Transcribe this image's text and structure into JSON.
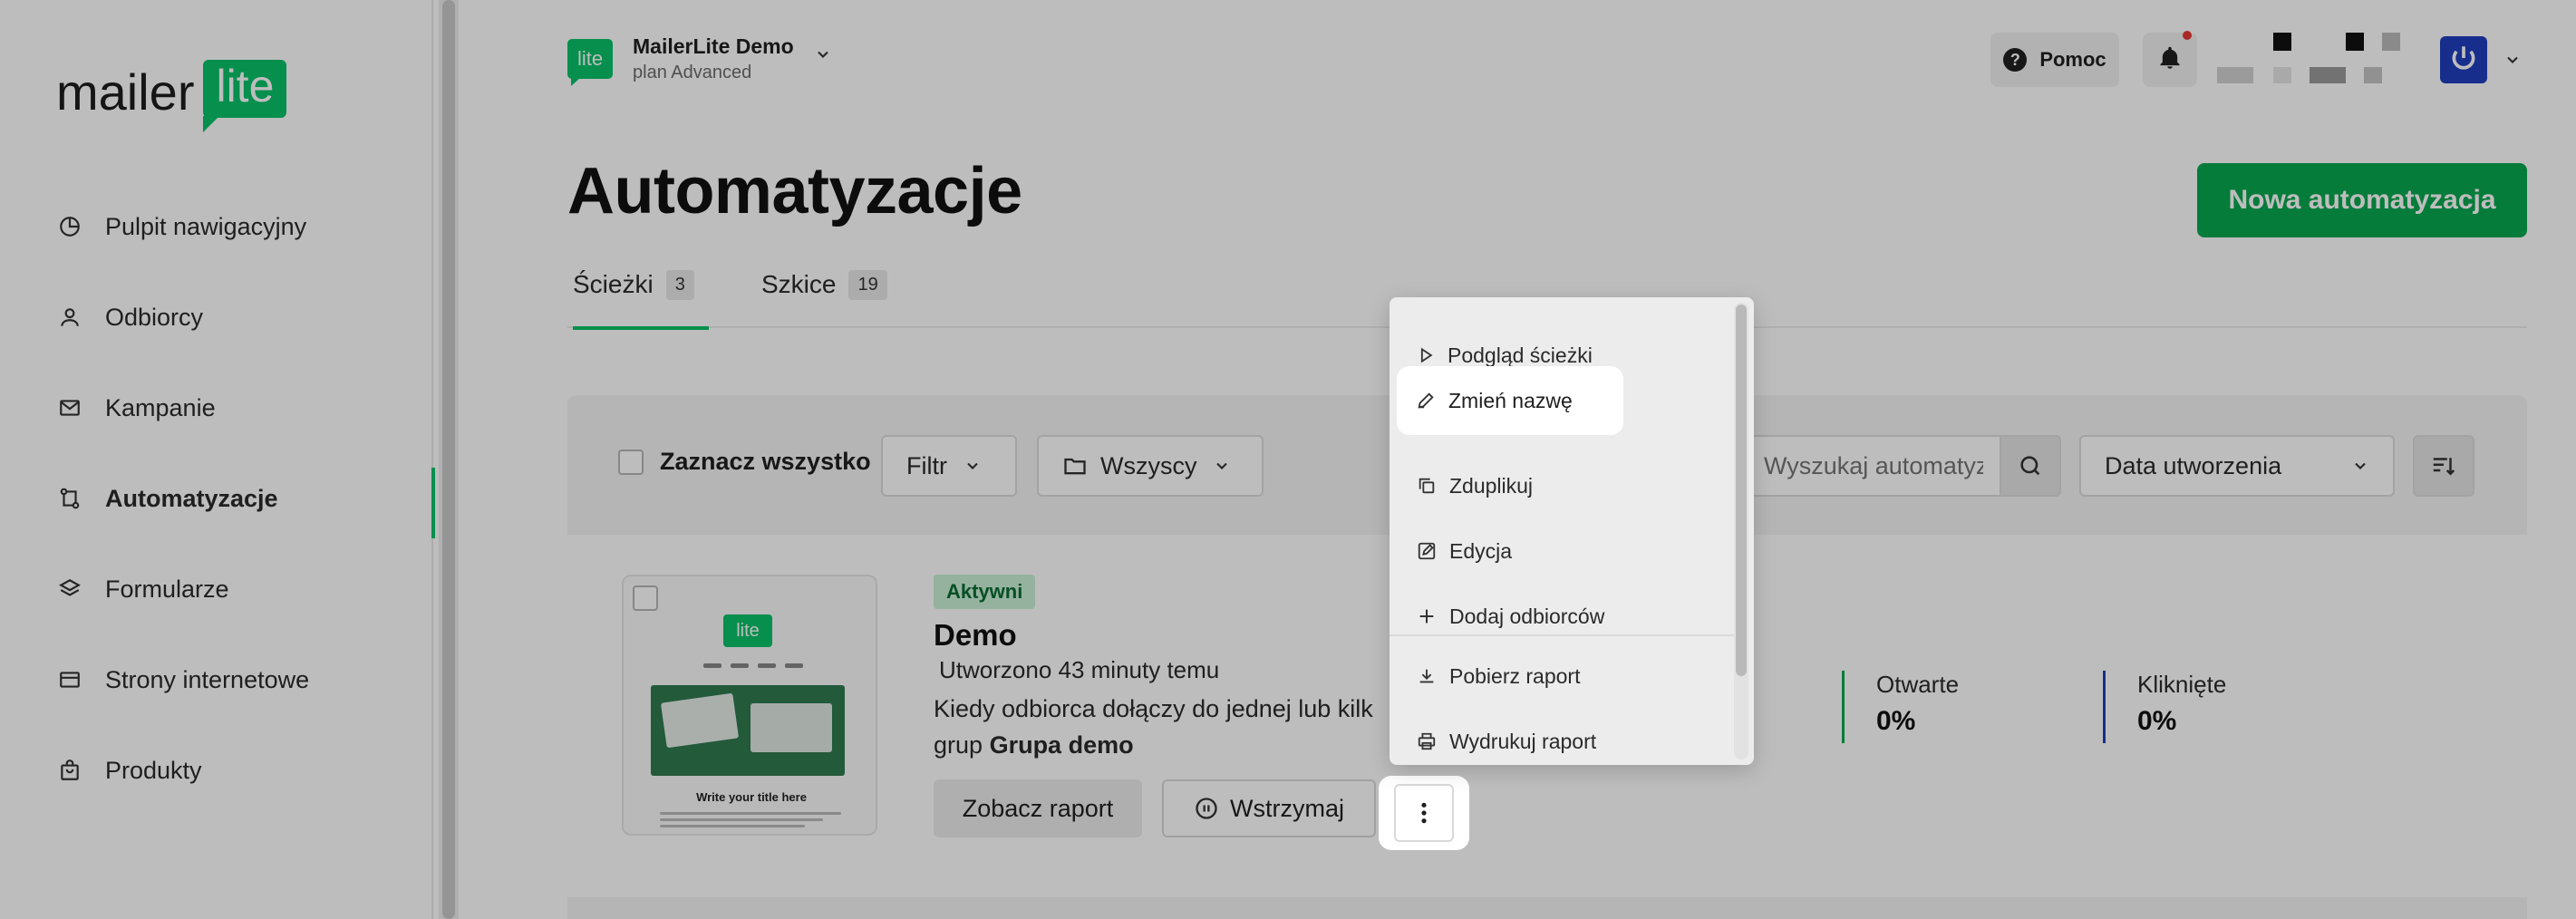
{
  "sidebar": {
    "logo": {
      "word": "mailer",
      "badge": "lite"
    },
    "items": [
      {
        "label": "Pulpit nawigacyjny",
        "icon": "dashboard-icon"
      },
      {
        "label": "Odbiorcy",
        "icon": "user-icon"
      },
      {
        "label": "Kampanie",
        "icon": "mail-icon"
      },
      {
        "label": "Automatyzacje",
        "icon": "automation-icon",
        "active": true
      },
      {
        "label": "Formularze",
        "icon": "layers-icon"
      },
      {
        "label": "Strony internetowe",
        "icon": "browser-icon"
      },
      {
        "label": "Produkty",
        "icon": "bag-icon"
      }
    ]
  },
  "header": {
    "account_logo": "lite",
    "account_name": "MailerLite Demo",
    "account_plan": "plan Advanced",
    "help_label": "Pomoc"
  },
  "page": {
    "title": "Automatyzacje",
    "new_button": "Nowa automatyzacja",
    "tabs": [
      {
        "label": "Ścieżki",
        "count": "3",
        "active": true
      },
      {
        "label": "Szkice",
        "count": "19"
      }
    ]
  },
  "toolbar": {
    "select_all": "Zaznacz wszystko",
    "filter": "Filtr",
    "group": "Wszyscy",
    "search_placeholder": "Wyszukaj automatyzacje",
    "sort": "Data utworzenia"
  },
  "automation": {
    "status": "Aktywni",
    "name": "Demo",
    "created": "Utworzono 43 minuty temu",
    "desc_prefix": "Kiedy odbiorca dołączy do jednej lub kilk",
    "desc_line2": "grup",
    "group_name": "Grupa demo",
    "report_button": "Zobacz raport",
    "pause_button": "Wstrzymaj",
    "thumb": {
      "logo": "lite",
      "title": "Write your title here"
    },
    "stats": [
      {
        "label": "Otwarte",
        "value": "0%",
        "color": "#09a84f"
      },
      {
        "label": "Kliknięte",
        "value": "0%",
        "color": "#1f3fbf"
      }
    ]
  },
  "menu": {
    "items": [
      {
        "label": "Podgląd ścieżki",
        "icon": "play-icon"
      },
      {
        "label": "Zmień nazwę",
        "icon": "pencil-icon"
      },
      {
        "label": "Zduplikuj",
        "icon": "duplicate-icon"
      },
      {
        "label": "Edycja",
        "icon": "edit-icon"
      },
      {
        "label": "Dodaj odbiorców",
        "icon": "plus-icon"
      },
      {
        "label": "Pobierz raport",
        "icon": "download-icon"
      },
      {
        "label": "Wydrukuj raport",
        "icon": "print-icon"
      }
    ]
  },
  "colors": {
    "brand_green": "#09c269",
    "button_green": "#09a84f",
    "avatar_blue": "#1f3fbf",
    "notification_red": "#e53935"
  }
}
